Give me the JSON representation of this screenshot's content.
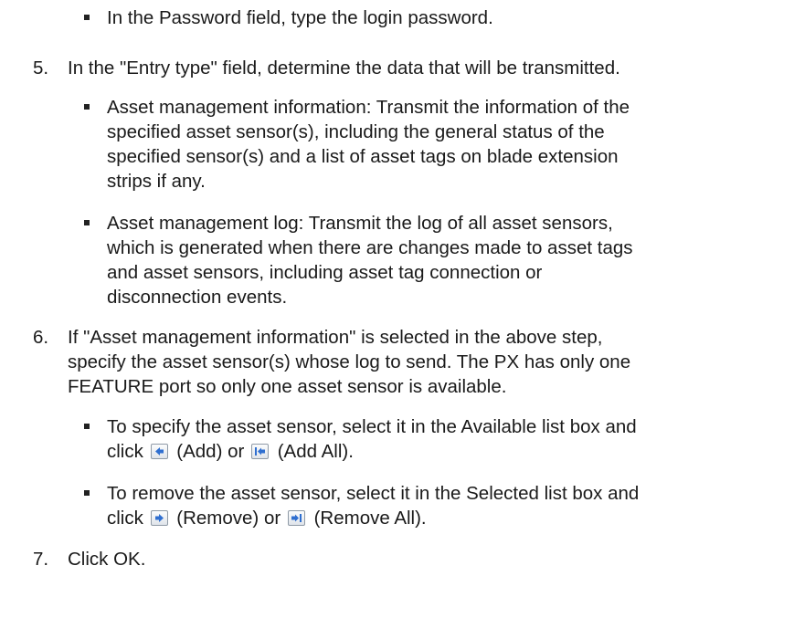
{
  "lines": {
    "l01": "In the Password field, type the login password.",
    "n5": "5.",
    "l02": "In the \"Entry type\" field, determine the data that will be transmitted.",
    "l03": "Asset management information: Transmit the information of the",
    "l04": "specified asset sensor(s), including the general status of the",
    "l05": "specified sensor(s) and a list of asset tags on blade extension",
    "l06": "strips if any.",
    "l07": "Asset management log: Transmit the log of all asset sensors,",
    "l08": "which is generated when there are changes made to asset tags",
    "l09": "and asset sensors, including asset tag connection or",
    "l10": "disconnection events.",
    "n6": "6.",
    "l11": "If \"Asset management information\" is selected in the above step,",
    "l12": "specify the asset sensor(s) whose log to send. The PX has only one",
    "l13": "FEATURE port so only one asset sensor is available.",
    "l14": "To specify the asset sensor, select it in the Available list box and",
    "l15a": "click",
    "l15b": "(Add) or",
    "l15c": "(Add All).",
    "l16": "To remove the asset sensor, select it in the Selected list box and",
    "l17a": "click",
    "l17b": "(Remove) or",
    "l17c": "(Remove All).",
    "n7": "7.",
    "l18": "Click OK."
  },
  "icons": {
    "add": "arrow-left-icon",
    "add_all": "arrow-left-bar-icon",
    "remove": "arrow-right-icon",
    "remove_all": "arrow-right-bar-icon"
  },
  "colors": {
    "text": "#1a1a1a",
    "icon_arrow": "#2f6fd0"
  }
}
